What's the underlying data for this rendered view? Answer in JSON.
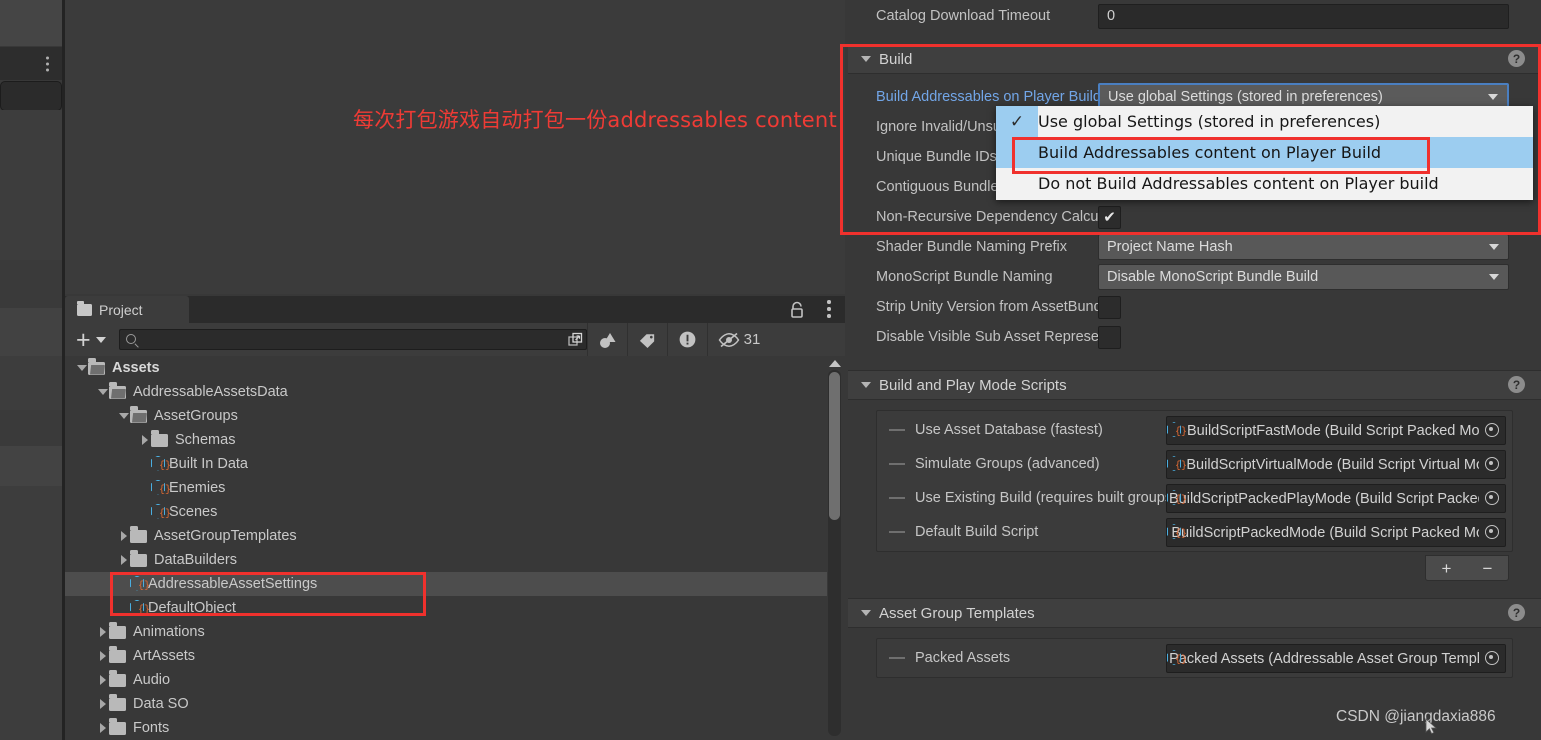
{
  "annotation": {
    "text": "每次打包游戏自动打包一份addressables content",
    "color": "#ef3b35"
  },
  "watermark": "CSDN @jiangdaxia886",
  "project_panel": {
    "tab_label": "Project",
    "lock_icon": "lock-icon",
    "menu_icon": "kebab-menu-icon",
    "toolbar": {
      "add_label": "+",
      "search_value": "",
      "search_placeholder": "",
      "icons": [
        "search-expand-icon",
        "shapes-filter-icon",
        "label-filter-icon",
        "warning-filter-icon"
      ],
      "hidden_count": "31"
    },
    "tree": [
      {
        "label": "Assets",
        "depth": 0,
        "type": "folder-open",
        "twisty": "down",
        "bold": true,
        "selected": false
      },
      {
        "label": "AddressableAssetsData",
        "depth": 1,
        "type": "folder-open",
        "twisty": "down",
        "bold": false,
        "selected": false
      },
      {
        "label": "AssetGroups",
        "depth": 2,
        "type": "folder-open",
        "twisty": "down",
        "bold": false,
        "selected": false
      },
      {
        "label": "Schemas",
        "depth": 3,
        "type": "folder",
        "twisty": "right",
        "bold": false,
        "selected": false
      },
      {
        "label": "Built In Data",
        "depth": 3,
        "type": "scriptable-object",
        "twisty": "none",
        "bold": false,
        "selected": false
      },
      {
        "label": "Enemies",
        "depth": 3,
        "type": "scriptable-object",
        "twisty": "none",
        "bold": false,
        "selected": false
      },
      {
        "label": "Scenes",
        "depth": 3,
        "type": "scriptable-object",
        "twisty": "none",
        "bold": false,
        "selected": false
      },
      {
        "label": "AssetGroupTemplates",
        "depth": 2,
        "type": "folder",
        "twisty": "right",
        "bold": false,
        "selected": false
      },
      {
        "label": "DataBuilders",
        "depth": 2,
        "type": "folder",
        "twisty": "right",
        "bold": false,
        "selected": false
      },
      {
        "label": "AddressableAssetSettings",
        "depth": 2,
        "type": "scriptable-object",
        "twisty": "none",
        "bold": false,
        "selected": true
      },
      {
        "label": "DefaultObject",
        "depth": 2,
        "type": "scriptable-object",
        "twisty": "none",
        "bold": false,
        "selected": false
      },
      {
        "label": "Animations",
        "depth": 1,
        "type": "folder",
        "twisty": "right",
        "bold": false,
        "selected": false
      },
      {
        "label": "ArtAssets",
        "depth": 1,
        "type": "folder",
        "twisty": "right",
        "bold": false,
        "selected": false
      },
      {
        "label": "Audio",
        "depth": 1,
        "type": "folder",
        "twisty": "right",
        "bold": false,
        "selected": false
      },
      {
        "label": "Data SO",
        "depth": 1,
        "type": "folder",
        "twisty": "right",
        "bold": false,
        "selected": false
      },
      {
        "label": "Fonts",
        "depth": 1,
        "type": "folder",
        "twisty": "right",
        "bold": false,
        "selected": false
      }
    ]
  },
  "inspector": {
    "catalog_timeout": {
      "label": "Catalog Download Timeout",
      "value": "0"
    },
    "build_section": {
      "title": "Build",
      "help_icon": "help-icon",
      "rows": {
        "build_on_player_build": {
          "label": "Build Addressables on Player Build",
          "value": "Use global Settings (stored in preferences)"
        },
        "ignore_invalid": {
          "label": "Ignore Invalid/Unsupported Files in Build"
        },
        "unique_bundle": {
          "label": "Unique Bundle IDs"
        },
        "contiguous_bundles": {
          "label": "Contiguous Bundles",
          "checked": true
        },
        "non_recursive": {
          "label": "Non-Recursive Dependency Calculation",
          "checked": true
        },
        "shader_bundle_naming": {
          "label": "Shader Bundle Naming Prefix",
          "value": "Project Name Hash"
        },
        "monoscript_bundle_naming": {
          "label": "MonoScript Bundle Naming",
          "value": "Disable MonoScript Bundle Build"
        },
        "strip_unity_version": {
          "label": "Strip Unity Version from AssetBundles",
          "checked": false
        },
        "disable_visible_sub": {
          "label": "Disable Visible Sub Asset Representation",
          "checked": false
        }
      }
    },
    "build_play_scripts": {
      "title": "Build and Play Mode Scripts",
      "help_icon": "help-icon",
      "rows": [
        {
          "name": "Use Asset Database (fastest)",
          "object": "BuildScriptFastMode (Build Script Packed Mode)"
        },
        {
          "name": "Simulate Groups (advanced)",
          "object": "BuildScriptVirtualMode (Build Script Virtual Mode)"
        },
        {
          "name": "Use Existing Build (requires built groups)",
          "object": "BuildScriptPackedPlayMode (Build Script Packed Play Mode)"
        },
        {
          "name": "Default Build Script",
          "object": "BuildScriptPackedMode (Build Script Packed Mode)"
        }
      ],
      "add_label": "+",
      "remove_label": "−"
    },
    "asset_group_templates": {
      "title": "Asset Group Templates",
      "help_icon": "help-icon",
      "rows": [
        {
          "name": "Packed Assets",
          "object": "Packed Assets (Addressable Asset Group Template)"
        }
      ]
    }
  },
  "dropdown": {
    "items": [
      {
        "label": "Use global Settings (stored in preferences)",
        "checked": true,
        "selected": false
      },
      {
        "label": "Build Addressables content on Player Build",
        "checked": false,
        "selected": true
      },
      {
        "label": "Do not Build Addressables content on Player build",
        "checked": false,
        "selected": false
      }
    ]
  }
}
